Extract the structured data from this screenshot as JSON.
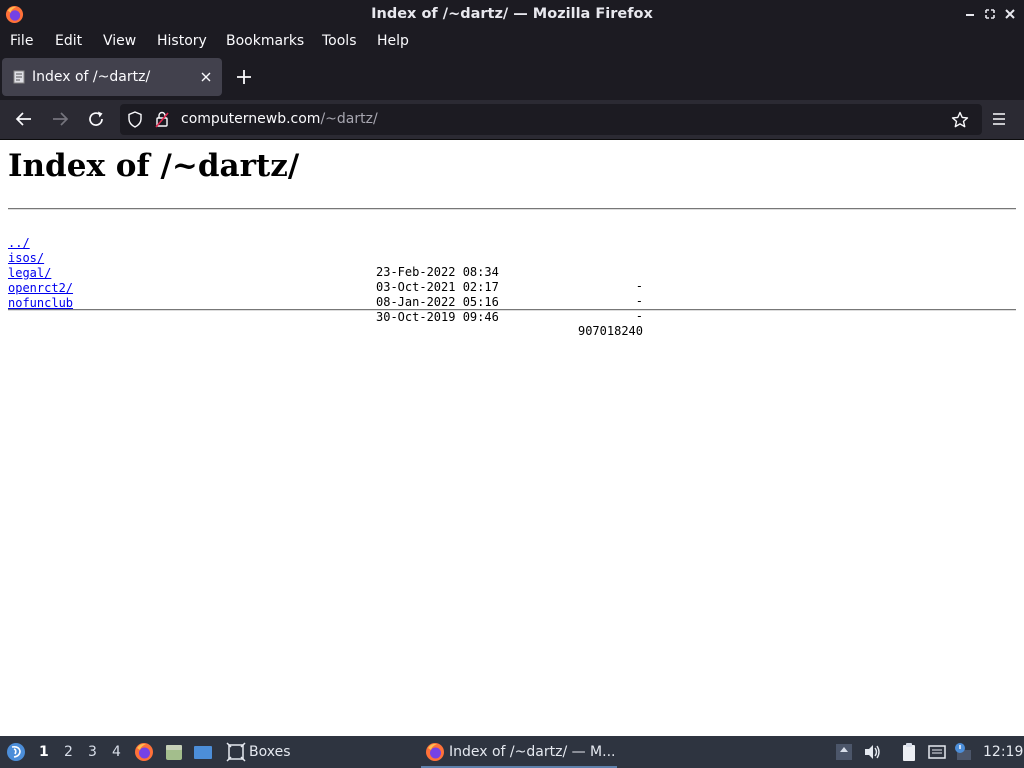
{
  "window": {
    "title": "Index of /~dartz/ — Mozilla Firefox"
  },
  "menubar": {
    "items": [
      {
        "label": "File"
      },
      {
        "label": "Edit"
      },
      {
        "label": "View"
      },
      {
        "label": "History"
      },
      {
        "label": "Bookmarks"
      },
      {
        "label": "Tools"
      },
      {
        "label": "Help"
      }
    ]
  },
  "tabs": [
    {
      "label": "Index of /~dartz/",
      "active": true
    }
  ],
  "navbar": {
    "url_host": "computernewb.com",
    "url_path": "/~dartz/"
  },
  "page": {
    "heading": "Index of /~dartz/",
    "entries": [
      {
        "name": "../",
        "date": "",
        "size": ""
      },
      {
        "name": "isos/",
        "date": "23-Feb-2022 08:34",
        "size": "-"
      },
      {
        "name": "legal/",
        "date": "03-Oct-2021 02:17",
        "size": "-"
      },
      {
        "name": "openrct2/",
        "date": "08-Jan-2022 05:16",
        "size": "-"
      },
      {
        "name": "nofunclub",
        "date": "30-Oct-2019 09:46",
        "size": "907018240"
      }
    ]
  },
  "taskbar": {
    "workspaces": [
      "1",
      "2",
      "3",
      "4"
    ],
    "active_workspace": "1",
    "apps": [
      {
        "label": "Boxes"
      },
      {
        "label": "Index of /~dartz/ — M..."
      }
    ],
    "clock": "12:19",
    "accent_color": "#5e81ac"
  },
  "colors": {
    "chrome_dark": "#1c1b22",
    "toolbar": "#2b2a33",
    "link": "#0000ee",
    "taskbar": "#2e3440"
  }
}
